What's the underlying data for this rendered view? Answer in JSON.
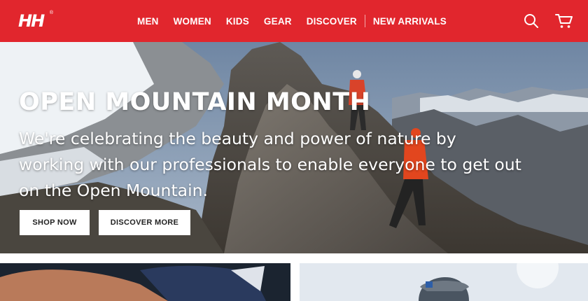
{
  "header": {
    "logo": "HH",
    "logo_mark": "®",
    "nav": [
      {
        "label": "MEN"
      },
      {
        "label": "WOMEN"
      },
      {
        "label": "KIDS"
      },
      {
        "label": "GEAR"
      },
      {
        "label": "DISCOVER"
      },
      {
        "label": "NEW ARRIVALS"
      }
    ],
    "icons": [
      "search-icon",
      "cart-icon"
    ],
    "accent": "#e1262d"
  },
  "hero": {
    "title": "OPEN MOUNTAIN MONTH",
    "body": "We're celebrating the beauty and power of nature by working with our professionals to enable everyone to get out on the Open Mountain.",
    "buttons": {
      "shop": "SHOP NOW",
      "discover": "DISCOVER MORE"
    }
  }
}
